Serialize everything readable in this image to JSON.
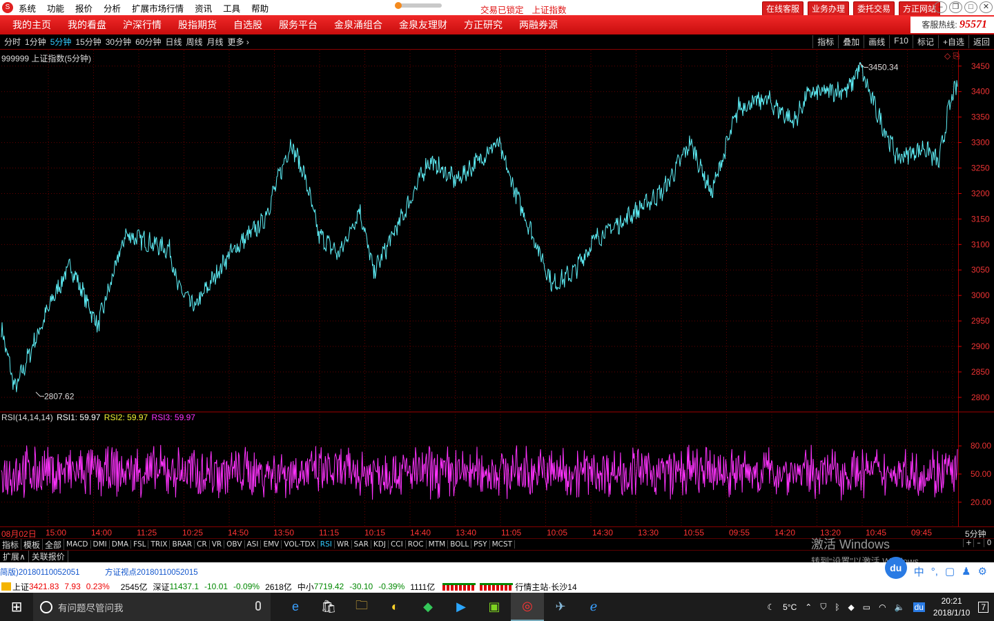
{
  "menu": {
    "logo": "S",
    "items": [
      "系统",
      "功能",
      "报价",
      "分析",
      "扩展市场行情",
      "资讯",
      "工具",
      "帮助"
    ],
    "lock_text": "交易已锁定",
    "index_name": "上证指数",
    "right_buttons": [
      "在线客服",
      "业务办理",
      "委托交易",
      "方正网站"
    ],
    "window_controls": [
      "–",
      "❐",
      "□",
      "✕"
    ]
  },
  "nav": {
    "items": [
      "我的主页",
      "我的看盘",
      "沪深行情",
      "股指期货",
      "自选股",
      "服务平台",
      "金泉涌组合",
      "金泉友理财",
      "方正研究",
      "两融券源"
    ],
    "hotline_label": "客服热线:",
    "hotline_number": "95571"
  },
  "periods": {
    "items": [
      "分时",
      "1分钟",
      "5分钟",
      "15分钟",
      "30分钟",
      "60分钟",
      "日线",
      "周线",
      "月线",
      "更多 ›"
    ],
    "active": "5分钟",
    "tools": [
      "指标",
      "叠加",
      "画线",
      "F10",
      "标记",
      "+自选",
      "返回"
    ]
  },
  "chart_data": [
    {
      "type": "line",
      "title": "999999 上证指数(5分钟)",
      "yticks": [
        3450,
        3400,
        3350,
        3300,
        3250,
        3200,
        3150,
        3100,
        3050,
        3000,
        2950,
        2900,
        2850,
        2800
      ],
      "ylim": [
        2785,
        3470
      ],
      "max_label": "3450.34",
      "min_label": "2807.62",
      "points": 1400,
      "anchors": [
        [
          0,
          2935
        ],
        [
          20,
          2815
        ],
        [
          45,
          2900
        ],
        [
          75,
          2995
        ],
        [
          100,
          3060
        ],
        [
          140,
          2940
        ],
        [
          180,
          3120
        ],
        [
          245,
          3090
        ],
        [
          255,
          3020
        ],
        [
          280,
          2975
        ],
        [
          330,
          3080
        ],
        [
          380,
          3145
        ],
        [
          420,
          3300
        ],
        [
          440,
          3235
        ],
        [
          460,
          3120
        ],
        [
          490,
          3080
        ],
        [
          520,
          3170
        ],
        [
          540,
          3045
        ],
        [
          580,
          3150
        ],
        [
          620,
          3265
        ],
        [
          660,
          3225
        ],
        [
          720,
          3300
        ],
        [
          745,
          3205
        ],
        [
          800,
          3020
        ],
        [
          830,
          3045
        ],
        [
          860,
          3110
        ],
        [
          900,
          3145
        ],
        [
          960,
          3205
        ],
        [
          1000,
          3300
        ],
        [
          1030,
          3200
        ],
        [
          1070,
          3370
        ],
        [
          1110,
          3385
        ],
        [
          1150,
          3340
        ],
        [
          1170,
          3395
        ],
        [
          1230,
          3405
        ],
        [
          1245,
          3450
        ],
        [
          1270,
          3360
        ],
        [
          1300,
          3270
        ],
        [
          1340,
          3290
        ],
        [
          1360,
          3260
        ],
        [
          1375,
          3370
        ],
        [
          1388,
          3420
        ]
      ],
      "series_color": "#5ff0f8"
    },
    {
      "type": "line",
      "title": "RSI(14,14,14)",
      "legend": [
        {
          "name": "RSI1",
          "value": "59.97",
          "color": "#ffffff"
        },
        {
          "name": "RSI2",
          "value": "59.97",
          "color": "#f5f535"
        },
        {
          "name": "RSI3",
          "value": "59.97",
          "color": "#ff33ff"
        }
      ],
      "yticks": [
        80,
        50,
        20
      ],
      "ylim": [
        0,
        100
      ],
      "series_color": "#ff33ff"
    }
  ],
  "time_axis": [
    "08月02日",
    "15:00",
    "14:00",
    "11:25",
    "10:25",
    "14:50",
    "13:50",
    "11:15",
    "10:15",
    "14:40",
    "13:40",
    "11:05",
    "10:05",
    "14:30",
    "13:30",
    "10:55",
    "09:55",
    "14:20",
    "13:20",
    "10:45",
    "09:45"
  ],
  "time_axis_period": "5分钟",
  "indicator_tabs": [
    "指标",
    "模板",
    "全部",
    "MACD",
    "DMI",
    "DMA",
    "FSL",
    "TRIX",
    "BRAR",
    "CR",
    "VR",
    "OBV",
    "ASI",
    "EMV",
    "VOL-TDX",
    "RSI",
    "WR",
    "SAR",
    "KDJ",
    "CCI",
    "ROC",
    "MTM",
    "BOLL",
    "PSY",
    "MCST"
  ],
  "indicator_active": "RSI",
  "indicator_controls": [
    "+",
    "–",
    "0"
  ],
  "ext_tabs": [
    "扩展∧",
    "关联报价"
  ],
  "watermark": {
    "line1": "激活 Windows",
    "line2": "转到“设置”以激活 Windows。"
  },
  "news": [
    "简版)20180110052051",
    "方证视点20180110052015"
  ],
  "baidu": [
    "du",
    "中",
    "°,",
    "▢",
    "♟",
    "⚙"
  ],
  "status": {
    "sh_label": "上证",
    "sh_value": "3421.83",
    "sh_change": "7.93",
    "sh_pct": "0.23%",
    "sh_amount": "2545亿",
    "sz_label": "深证",
    "sz_value": "11437.1",
    "sz_change": "-10.01",
    "sz_pct": "-0.09%",
    "sz_amount": "2618亿",
    "zx_label": "中小",
    "zx_value": "7719.42",
    "zx_change": "-30.10",
    "zx_pct": "-0.39%",
    "zx_amount": "1111亿",
    "station": "行情主站·长沙14"
  },
  "taskbar": {
    "search_placeholder": "有问题尽管问我",
    "weather": "5°C",
    "time": "20:21",
    "date": "2018/1/10",
    "notif": "7"
  }
}
